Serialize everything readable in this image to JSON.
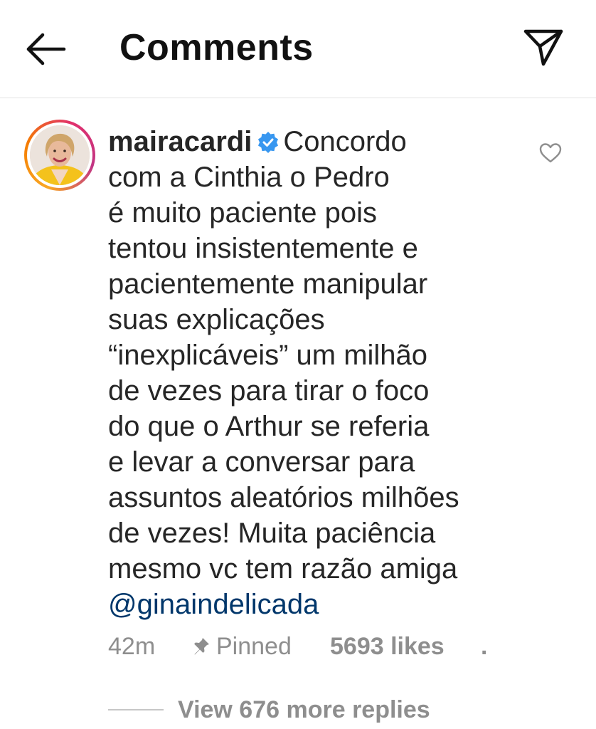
{
  "header": {
    "title": "Comments",
    "back_icon": "arrow-left-icon",
    "send_icon": "paper-plane-icon"
  },
  "comment": {
    "username": "mairacardi",
    "verified": true,
    "first_line_text": "Concordo",
    "lines": [
      "com a Cinthia o Pedro",
      "é muito paciente pois",
      "tentou insistentemente e",
      "pacientemente manipular",
      "suas explicações",
      "“inexplicáveis” um milhão",
      "de vezes para tirar o foco",
      "do que o Arthur se referia",
      "e levar a conversar para",
      "assuntos aleatórios milhões",
      "de vezes! Muita paciência",
      "mesmo vc tem razão amiga"
    ],
    "mention": "@ginaindelicada",
    "time": "42m",
    "pinned_label": "Pinned",
    "likes_label": "5693 likes",
    "more_label": ".",
    "replies_label": "View 676 more replies"
  },
  "colors": {
    "text": "#262626",
    "secondary": "#8e8e8e",
    "mention": "#00376b",
    "verified": "#3897f0",
    "divider": "#e4e4e4"
  }
}
